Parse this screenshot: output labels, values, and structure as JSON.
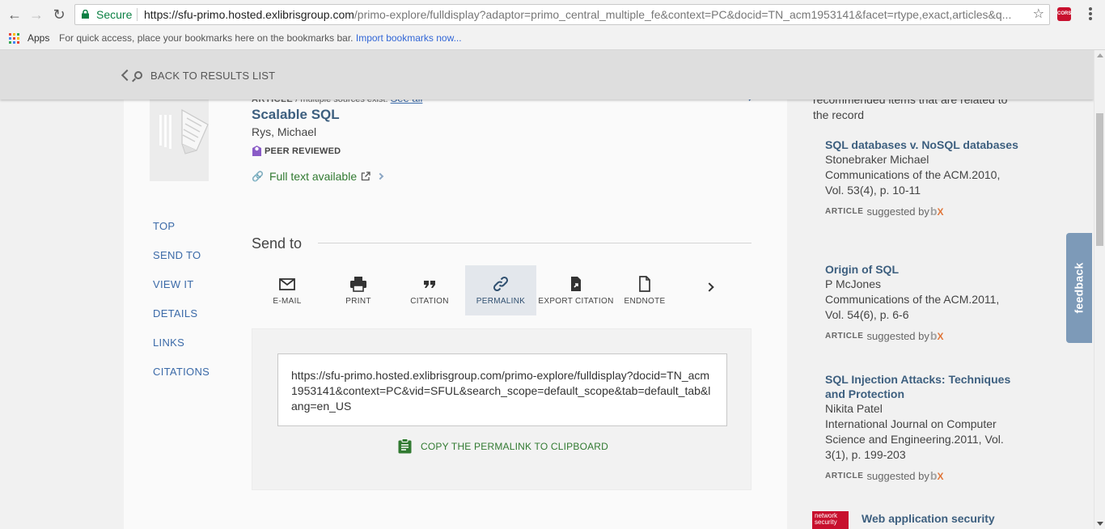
{
  "browser": {
    "secure_label": "Secure",
    "url_host": "https://sfu-primo.hosted.exlibrisgroup.com",
    "url_path": "/primo-explore/fulldisplay?adaptor=primo_central_multiple_fe&context=PC&docid=TN_acm1953141&facet=rtype,exact,articles&q...",
    "extension_label": "CORS"
  },
  "bookmarks": {
    "apps_label": "Apps",
    "hint": "For quick access, place your bookmarks here on the bookmarks bar.",
    "import_link": "Import bookmarks now..."
  },
  "topbar": {
    "back_label": "BACK TO RESULTS LIST"
  },
  "record": {
    "type": "ARTICLE",
    "sources_text": " / multiple sources exist.",
    "see_all": "See all",
    "title": "Scalable SQL",
    "author": "Rys, Michael",
    "peer_reviewed": "PEER REVIEWED",
    "full_text": "Full text available"
  },
  "left_nav": {
    "items": [
      "TOP",
      "SEND TO",
      "VIEW IT",
      "DETAILS",
      "LINKS",
      "CITATIONS"
    ]
  },
  "send_to": {
    "title": "Send to",
    "actions": [
      "E-MAIL",
      "PRINT",
      "CITATION",
      "PERMALINK",
      "EXPORT CITATION",
      "ENDNOTE"
    ],
    "active": "PERMALINK",
    "permalink_url": "https://sfu-primo.hosted.exlibrisgroup.com/primo-explore/fulldisplay?docid=TN_acm1953141&context=PC&vid=SFUL&search_scope=default_scope&tab=default_tab&lang=en_US",
    "copy_label": "COPY THE PERMALINK TO CLIPBOARD"
  },
  "recommendations": {
    "intro": "recommended items that are related to the record",
    "suggested_by": "suggested by",
    "article_type": "ARTICLE",
    "items": [
      {
        "title": "SQL databases v. NoSQL databases",
        "author": "Stonebraker Michael",
        "source": "Communications of the ACM.2010, Vol. 53(4), p. 10-11"
      },
      {
        "title": "Origin of SQL",
        "author": "P McJones",
        "source": "Communications of the ACM.2011, Vol. 54(6), p. 6-6"
      },
      {
        "title": "SQL Injection Attacks: Techniques and Protection",
        "author": "Nikita Patel",
        "source": "International Journal on Computer Science and Engineering.2011, Vol. 3(1), p. 199-203"
      }
    ],
    "last_item_title": "Web application security",
    "last_item_thumb_text": "network security"
  },
  "feedback_label": "feedback",
  "colors": {
    "link_blue": "#3b6aa8",
    "title_blue": "#3d5f7f",
    "green": "#317a31",
    "feedback_bg": "#7d9ab8",
    "peer_purple": "#8a5cc7"
  }
}
